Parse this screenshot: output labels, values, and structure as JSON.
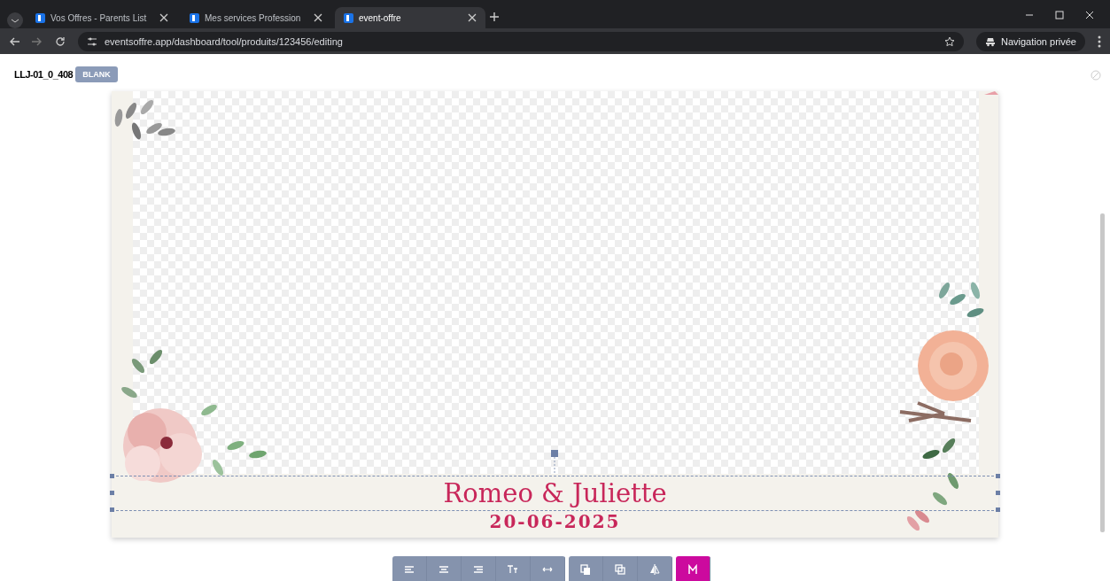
{
  "browser": {
    "tabs": [
      {
        "title": "Vos Offres - Parents List",
        "selected": false
      },
      {
        "title": "Mes services Profession",
        "selected": false
      },
      {
        "title": "event-offre",
        "selected": true
      }
    ],
    "url": "eventsoffre.app/dashboard/tool/produits/123456/editing",
    "profile": "Navigation privée"
  },
  "editor": {
    "code": "LLJ-01_0_408",
    "badge": "BLANK"
  },
  "card": {
    "title": "Romeo & Juliette",
    "date": "20-06-2025"
  },
  "toolbar": [
    {
      "kind": "align-left",
      "selected": false
    },
    {
      "kind": "align-center",
      "selected": false
    },
    {
      "kind": "align-right",
      "selected": false
    },
    {
      "kind": "text-size",
      "selected": false
    },
    {
      "kind": "spacing",
      "selected": false
    },
    {
      "kind": "copy",
      "selected": false
    },
    {
      "kind": "duplicate",
      "selected": false
    },
    {
      "kind": "flip",
      "selected": false
    },
    {
      "kind": "color",
      "selected": true
    }
  ]
}
